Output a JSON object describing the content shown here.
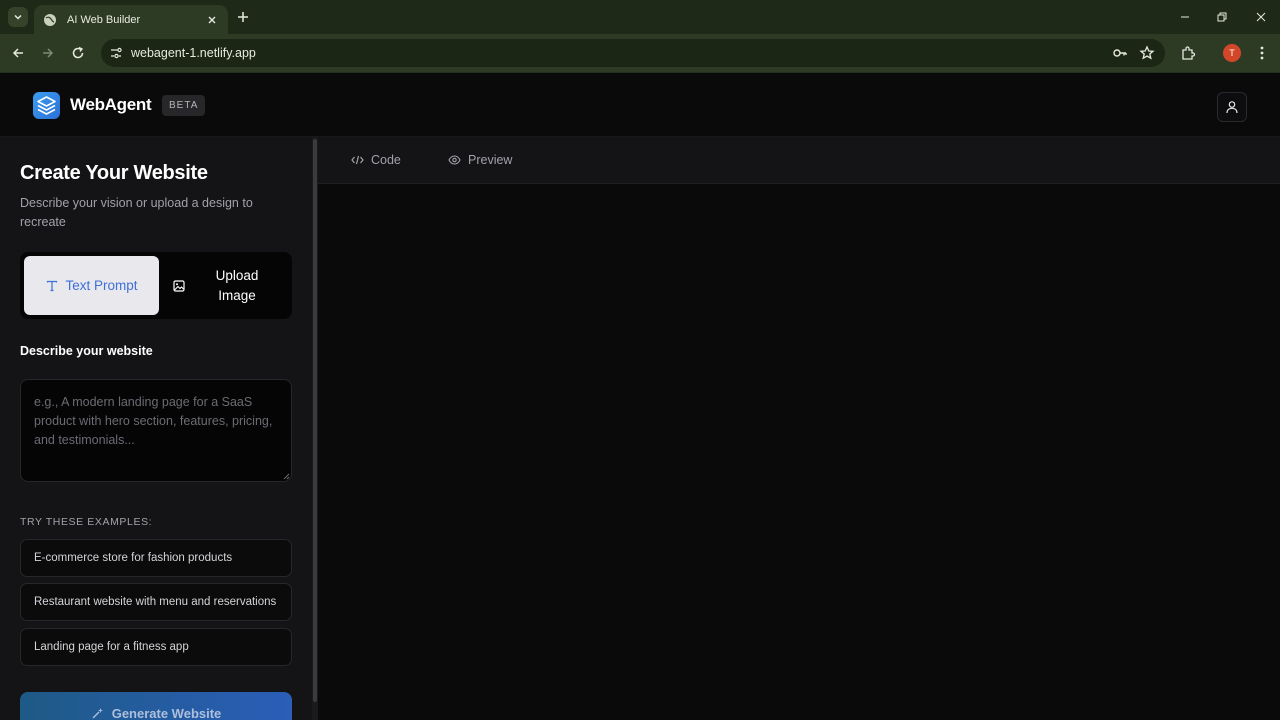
{
  "browser": {
    "tab_title": "AI Web Builder",
    "url": "webagent-1.netlify.app",
    "profile_initial": "T"
  },
  "header": {
    "brand": "WebAgent",
    "badge": "BETA"
  },
  "panel": {
    "title": "Create Your Website",
    "subtitle": "Describe your vision or upload a design to recreate",
    "modes": {
      "text": "Text Prompt",
      "upload": "Upload Image",
      "selected": "text"
    },
    "describe_label": "Describe your website",
    "prompt_placeholder": "e.g., A modern landing page for a SaaS product with hero section, features, pricing, and testimonials...",
    "prompt_value": "",
    "examples_label": "TRY THESE EXAMPLES:",
    "examples": [
      "E-commerce store for fashion products",
      "Restaurant website with menu and reservations",
      "Landing page for a fitness app"
    ],
    "generate_label": "Generate Website"
  },
  "main": {
    "tabs": [
      "Code",
      "Preview"
    ]
  },
  "colors": {
    "accent": "#3f6fd8",
    "browser_frame": "#2d3a24",
    "app_bg": "#0a0a0b",
    "panel_bg": "#141416"
  }
}
